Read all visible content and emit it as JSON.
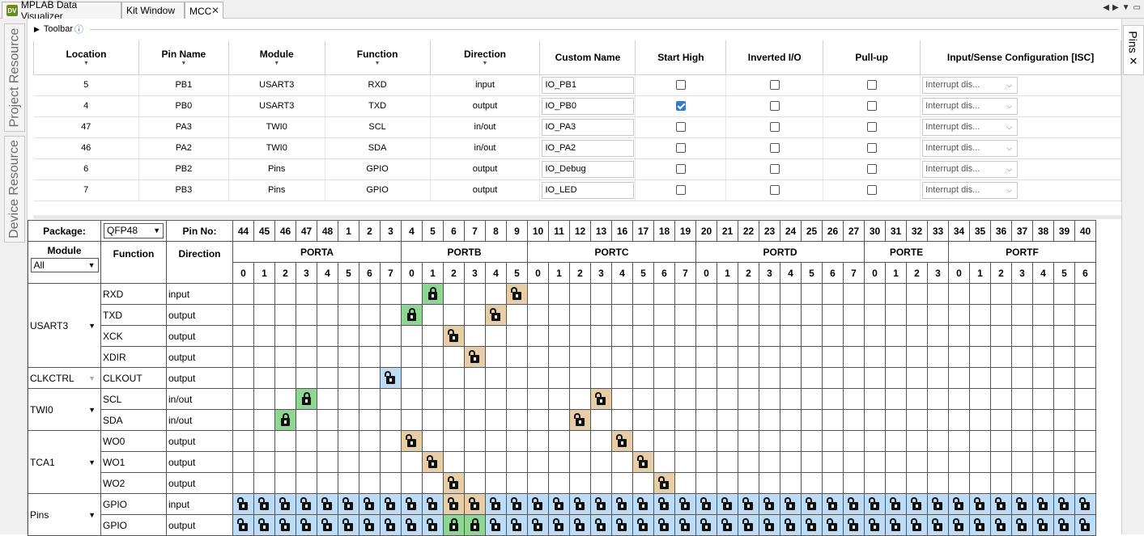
{
  "tabs": [
    {
      "label": "MPLAB Data Visualizer",
      "icon": "dv-icon"
    },
    {
      "label": "Kit Window"
    },
    {
      "label": "MCC",
      "active": true
    }
  ],
  "left_side_tabs": [
    "Project Resource",
    "Device Resource"
  ],
  "right_side_tab": "Pins",
  "toolbar": {
    "label": "Toolbar"
  },
  "module_table": {
    "headers": [
      "Location",
      "Pin Name",
      "Module",
      "Function",
      "Direction",
      "Custom Name",
      "Start High",
      "Inverted I/O",
      "Pull-up",
      "Input/Sense Configuration [ISC]"
    ],
    "rows": [
      {
        "location": "5",
        "pin": "PB1",
        "module": "USART3",
        "function": "RXD",
        "direction": "input",
        "custom": "IO_PB1",
        "start_high": false,
        "inverted": false,
        "pullup": false,
        "isc": "Interrupt dis..."
      },
      {
        "location": "4",
        "pin": "PB0",
        "module": "USART3",
        "function": "TXD",
        "direction": "output",
        "custom": "IO_PB0",
        "start_high": true,
        "inverted": false,
        "pullup": false,
        "isc": "Interrupt dis..."
      },
      {
        "location": "47",
        "pin": "PA3",
        "module": "TWI0",
        "function": "SCL",
        "direction": "in/out",
        "custom": "IO_PA3",
        "start_high": false,
        "inverted": false,
        "pullup": false,
        "isc": "Interrupt dis..."
      },
      {
        "location": "46",
        "pin": "PA2",
        "module": "TWI0",
        "function": "SDA",
        "direction": "in/out",
        "custom": "IO_PA2",
        "start_high": false,
        "inverted": false,
        "pullup": false,
        "isc": "Interrupt dis..."
      },
      {
        "location": "6",
        "pin": "PB2",
        "module": "Pins",
        "function": "GPIO",
        "direction": "output",
        "custom": "IO_Debug",
        "start_high": false,
        "inverted": false,
        "pullup": false,
        "isc": "Interrupt dis..."
      },
      {
        "location": "7",
        "pin": "PB3",
        "module": "Pins",
        "function": "GPIO",
        "direction": "output",
        "custom": "IO_LED",
        "start_high": false,
        "inverted": false,
        "pullup": false,
        "isc": "Interrupt dis..."
      }
    ]
  },
  "pin_grid": {
    "package_label": "Package:",
    "package_value": "QFP48",
    "pinno_label": "Pin No:",
    "module_label": "Module",
    "module_filter": "All",
    "function_label": "Function",
    "direction_label": "Direction",
    "pin_numbers": [
      "44",
      "45",
      "46",
      "47",
      "48",
      "1",
      "2",
      "3",
      "4",
      "5",
      "6",
      "7",
      "8",
      "9",
      "10",
      "11",
      "12",
      "13",
      "16",
      "17",
      "18",
      "19",
      "20",
      "21",
      "22",
      "23",
      "24",
      "25",
      "26",
      "27",
      "30",
      "31",
      "32",
      "33",
      "34",
      "35",
      "36",
      "37",
      "38",
      "39",
      "40"
    ],
    "ports": [
      {
        "name": "PORTA",
        "bits": [
          "0",
          "1",
          "2",
          "3",
          "4",
          "5",
          "6",
          "7"
        ]
      },
      {
        "name": "PORTB",
        "bits": [
          "0",
          "1",
          "2",
          "3",
          "4",
          "5"
        ]
      },
      {
        "name": "PORTC",
        "bits": [
          "0",
          "1",
          "2",
          "3",
          "4",
          "5",
          "6",
          "7"
        ]
      },
      {
        "name": "PORTD",
        "bits": [
          "0",
          "1",
          "2",
          "3",
          "4",
          "5",
          "6",
          "7"
        ]
      },
      {
        "name": "PORTE",
        "bits": [
          "0",
          "1",
          "2",
          "3"
        ]
      },
      {
        "name": "PORTF",
        "bits": [
          "0",
          "1",
          "2",
          "3",
          "4",
          "5",
          "6"
        ]
      }
    ],
    "modules": [
      {
        "name": "USART3",
        "enabled": true,
        "rows": [
          {
            "function": "RXD",
            "direction": "input",
            "cells": [
              {
                "col": 9,
                "state": "green-locked"
              },
              {
                "col": 13,
                "state": "tan-open"
              }
            ]
          },
          {
            "function": "TXD",
            "direction": "output",
            "cells": [
              {
                "col": 8,
                "state": "green-locked"
              },
              {
                "col": 12,
                "state": "tan-open"
              }
            ]
          },
          {
            "function": "XCK",
            "direction": "output",
            "cells": [
              {
                "col": 10,
                "state": "tan-open"
              }
            ]
          },
          {
            "function": "XDIR",
            "direction": "output",
            "cells": [
              {
                "col": 11,
                "state": "tan-open"
              }
            ]
          }
        ]
      },
      {
        "name": "CLKCTRL",
        "enabled": false,
        "rows": [
          {
            "function": "CLKOUT",
            "direction": "output",
            "cells": [
              {
                "col": 7,
                "state": "blue-open"
              }
            ]
          }
        ]
      },
      {
        "name": "TWI0",
        "enabled": true,
        "rows": [
          {
            "function": "SCL",
            "direction": "in/out",
            "cells": [
              {
                "col": 3,
                "state": "green-locked"
              },
              {
                "col": 17,
                "state": "tan-open"
              }
            ]
          },
          {
            "function": "SDA",
            "direction": "in/out",
            "cells": [
              {
                "col": 2,
                "state": "green-locked"
              },
              {
                "col": 16,
                "state": "tan-open"
              }
            ]
          }
        ]
      },
      {
        "name": "TCA1",
        "enabled": true,
        "rows": [
          {
            "function": "WO0",
            "direction": "output",
            "cells": [
              {
                "col": 8,
                "state": "tan-open"
              },
              {
                "col": 18,
                "state": "tan-open"
              }
            ]
          },
          {
            "function": "WO1",
            "direction": "output",
            "cells": [
              {
                "col": 9,
                "state": "tan-open"
              },
              {
                "col": 19,
                "state": "tan-open"
              }
            ]
          },
          {
            "function": "WO2",
            "direction": "output",
            "cells": [
              {
                "col": 10,
                "state": "tan-open"
              },
              {
                "col": 20,
                "state": "tan-open"
              }
            ]
          }
        ]
      },
      {
        "name": "Pins",
        "enabled": true,
        "rows": [
          {
            "function": "GPIO",
            "direction": "input",
            "fill": "blue-open",
            "cells": [
              {
                "col": 10,
                "state": "tan-open"
              },
              {
                "col": 11,
                "state": "tan-open"
              }
            ]
          },
          {
            "function": "GPIO",
            "direction": "output",
            "fill": "blue-open",
            "cells": [
              {
                "col": 10,
                "state": "green-locked"
              },
              {
                "col": 11,
                "state": "green-locked"
              }
            ]
          }
        ]
      }
    ]
  },
  "colors": {
    "locked": "#8fd694",
    "available": "#e6cfa8",
    "gpio": "#bfdcf7",
    "checkbox_on": "#2f7bd6"
  }
}
